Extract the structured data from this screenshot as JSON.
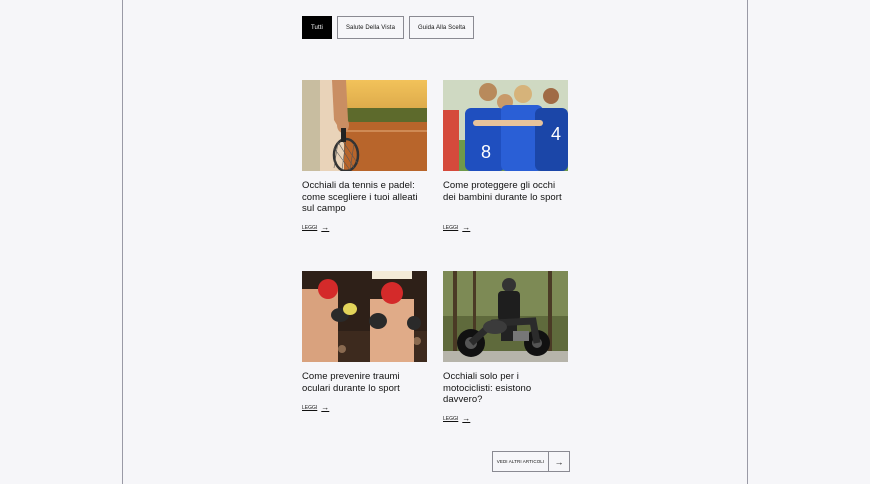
{
  "filters": [
    {
      "label": "Tutti",
      "active": true
    },
    {
      "label": "Salute Della Vista",
      "active": false
    },
    {
      "label": "Guida Alla Scelta",
      "active": false
    }
  ],
  "articles": [
    {
      "title": "Occhiali da tennis e padel: come scegliere i tuoi alleati sul campo",
      "link": "LEGGI",
      "image": "tennis-racket-photo"
    },
    {
      "title": "Come proteggere gli occhi dei bambini durante lo sport",
      "link": "LEGGI",
      "image": "kids-team-huddle-photo"
    },
    {
      "title": "Come prevenire traumi oculari durante lo sport",
      "link": "LEGGI",
      "image": "boxing-match-photo"
    },
    {
      "title": "Occhiali solo per i motociclisti: esistono davvero?",
      "link": "LEGGI",
      "image": "motorcyclist-photo"
    }
  ],
  "more_button": {
    "label": "VEDI ALTRI ARTICOLI",
    "icon": "arrow-right-icon"
  },
  "colors": {
    "background": "#f6f6f9",
    "active_filter": "#000000",
    "border": "#8a8a92"
  }
}
